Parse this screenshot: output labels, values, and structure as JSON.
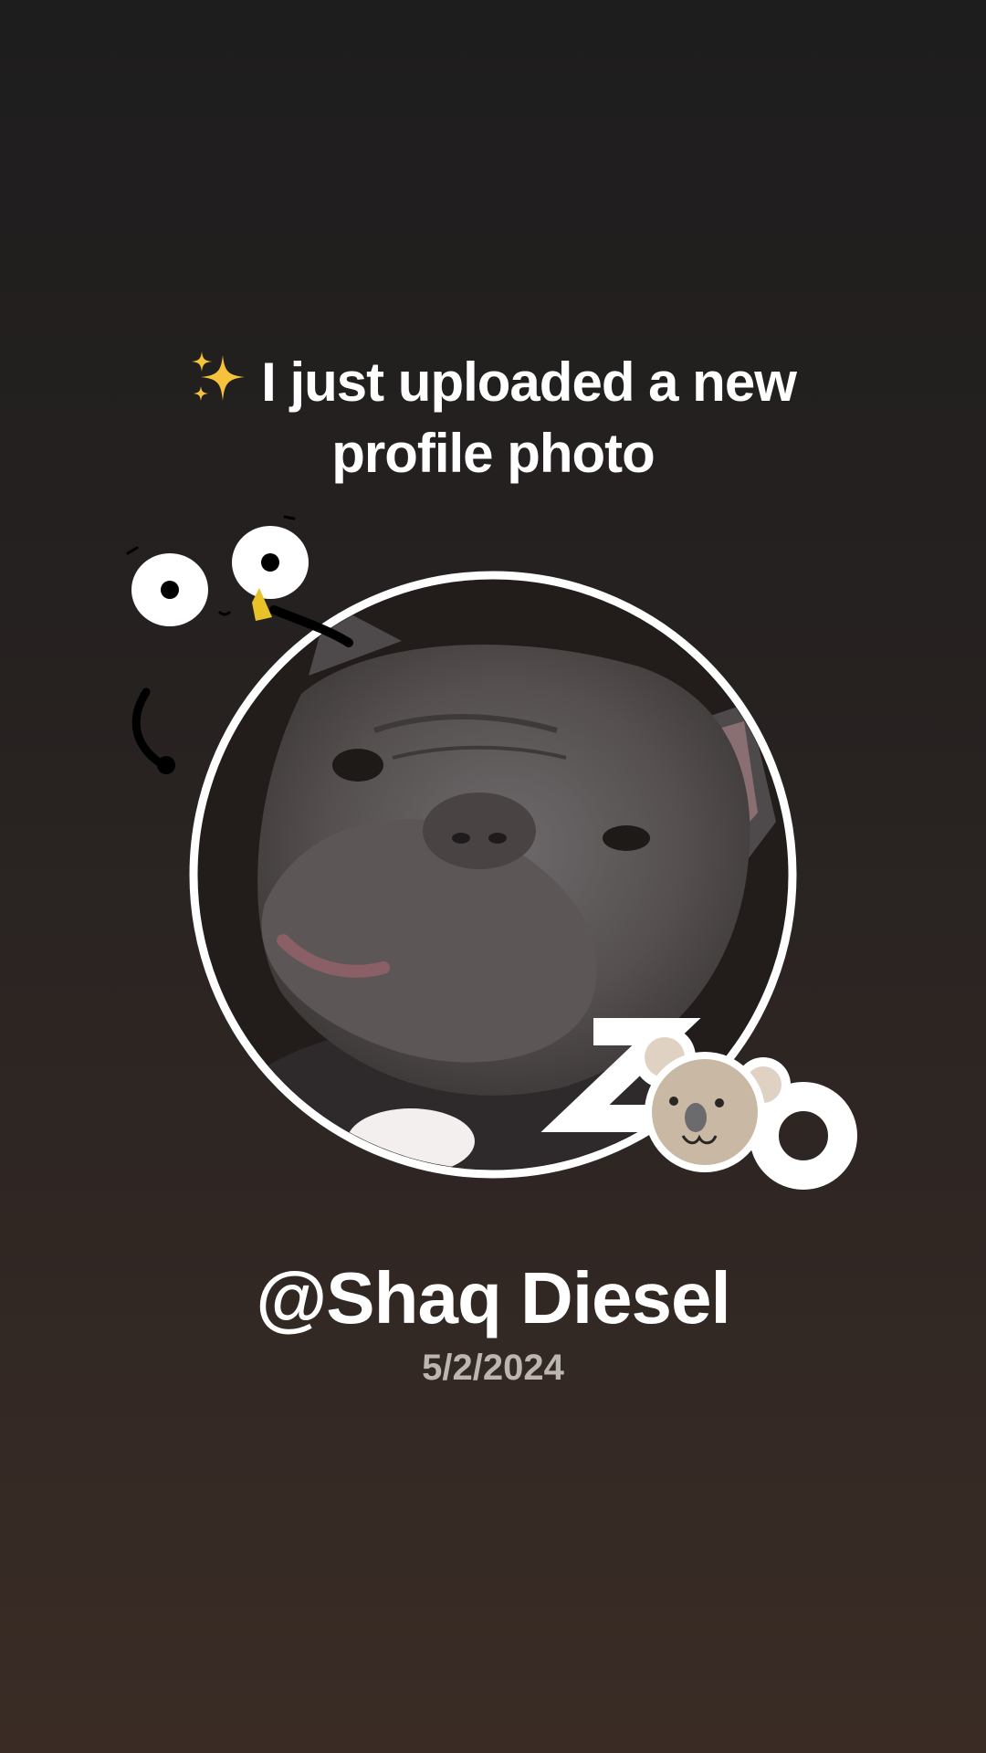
{
  "announcement": {
    "sparkle_icon": "sparkles-icon",
    "line1": "I just uploaded a new",
    "line2": "profile photo"
  },
  "profile": {
    "photo_icon": "dog-photo",
    "handle": "@Shaq Diesel",
    "date": "5/2/2024"
  },
  "stickers": {
    "face_doodle": "googly-eyes-doodle",
    "zoo_sticker": "zoo-koala-sticker"
  },
  "colors": {
    "background_top": "#1e1d1d",
    "background_bottom": "#3a2c25",
    "text": "#ffffff",
    "date_text": "#bcb6b2",
    "ring": "#ffffff",
    "koala": "#c9b8a3"
  }
}
